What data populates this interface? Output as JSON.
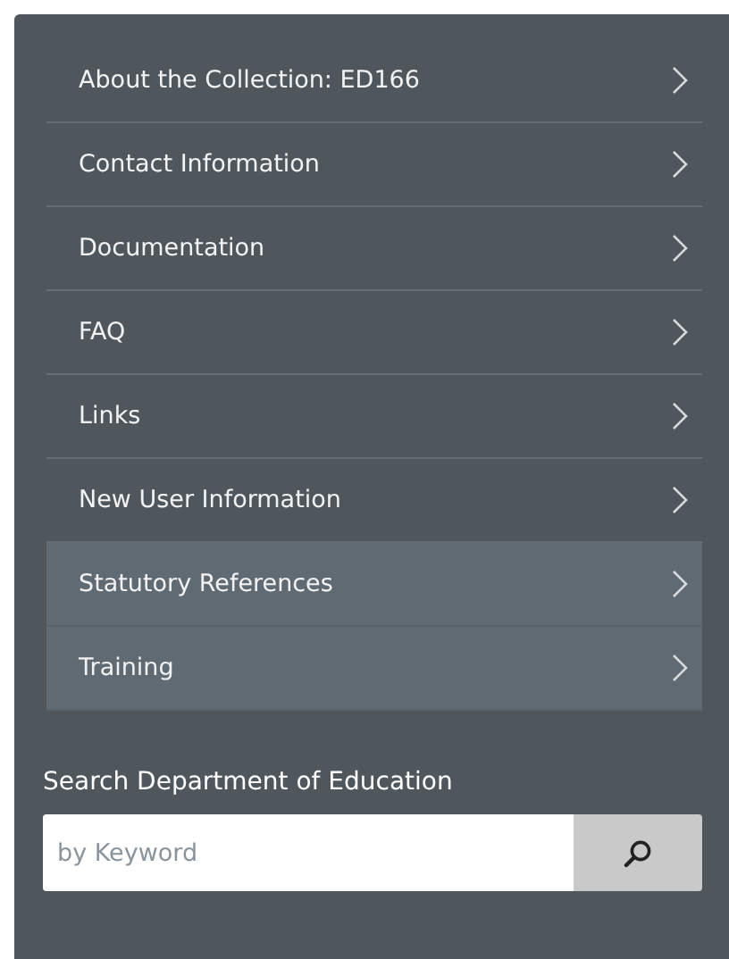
{
  "menu": [
    {
      "label": "About the Collection: ED166",
      "selected": false
    },
    {
      "label": "Contact Information",
      "selected": false
    },
    {
      "label": "Documentation",
      "selected": false
    },
    {
      "label": "FAQ",
      "selected": false
    },
    {
      "label": "Links",
      "selected": false
    },
    {
      "label": "New User Information",
      "selected": false
    },
    {
      "label": "Statutory References",
      "selected": true
    },
    {
      "label": "Training",
      "selected": true
    }
  ],
  "search": {
    "heading": "Search Department of Education",
    "placeholder": "by Keyword"
  }
}
